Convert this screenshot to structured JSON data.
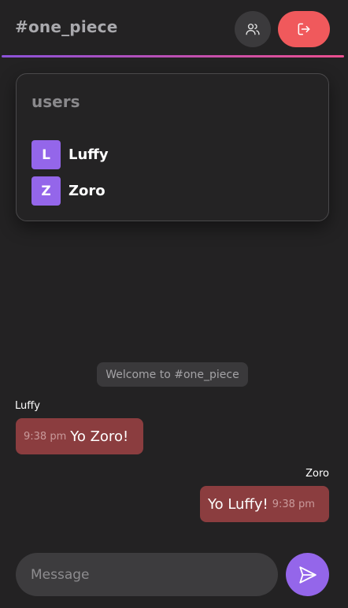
{
  "header": {
    "room_title": "#one_piece",
    "users_button_icon": "users-icon",
    "leave_button_icon": "log-out-icon",
    "accent_colors": [
      "#8b52d9",
      "#ec4f8e"
    ]
  },
  "users_panel": {
    "heading": "users",
    "users": [
      {
        "initial": "L",
        "name": "Luffy"
      },
      {
        "initial": "Z",
        "name": "Zoro"
      }
    ]
  },
  "chat": {
    "welcome": "Welcome to #one_piece",
    "messages": [
      {
        "sender": "Luffy",
        "time": "9:38 pm",
        "text": "Yo Zoro!",
        "side": "left"
      },
      {
        "sender": "Zoro",
        "time": "9:38 pm",
        "text": "Yo Luffy!",
        "side": "right"
      }
    ]
  },
  "composer": {
    "placeholder": "Message",
    "value": "",
    "send_icon": "send-icon"
  },
  "colors": {
    "background": "#232223",
    "bubble": "#8b3d3f",
    "accent_purple": "#9466ea",
    "leave_red": "#f0595c"
  }
}
